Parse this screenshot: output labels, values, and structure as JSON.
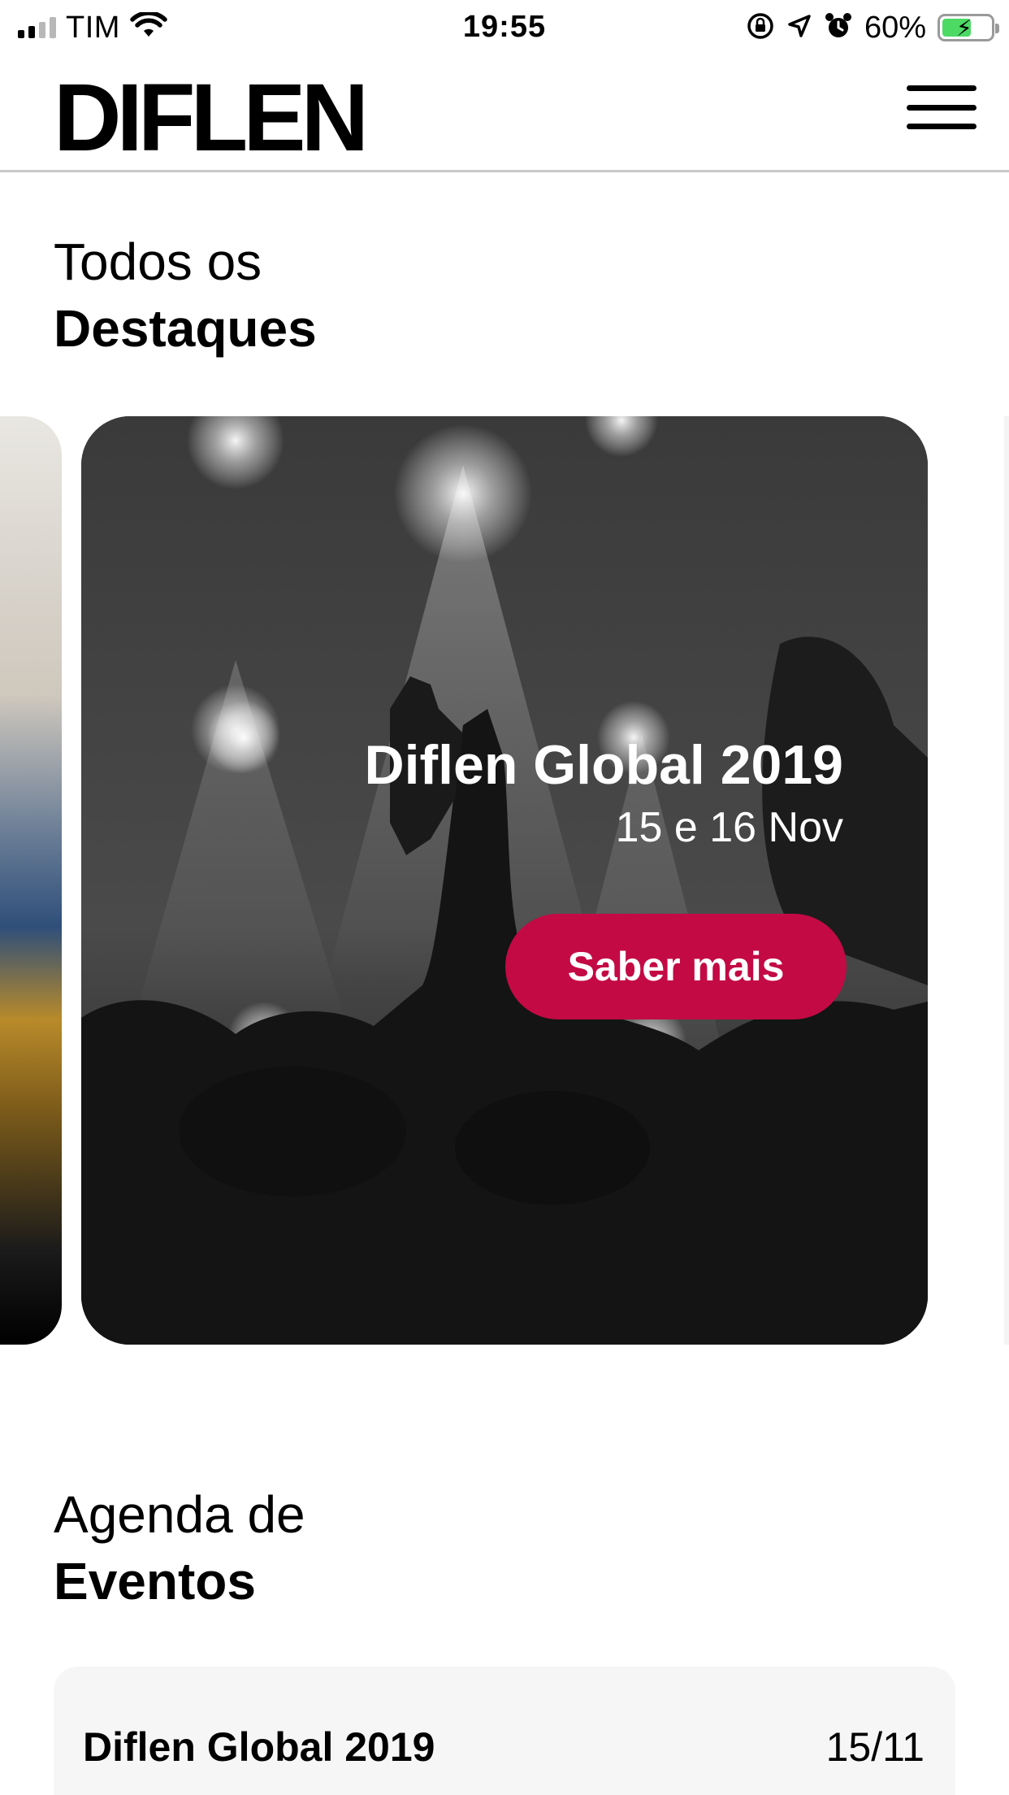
{
  "status_bar": {
    "carrier": "TIM",
    "time": "19:55",
    "battery_percent": "60%",
    "battery_level": 0.6,
    "icons": [
      "signal-icon",
      "wifi-icon",
      "orientation-lock-icon",
      "location-icon",
      "alarm-icon",
      "battery-charging-icon"
    ]
  },
  "header": {
    "logo": "DIFLEN",
    "menu_icon": "hamburger-menu-icon"
  },
  "highlights": {
    "title_light": "Todos os",
    "title_bold": "Destaques",
    "card": {
      "title": "Diflen Global 2019",
      "date": "15 e 16 Nov",
      "cta": "Saber mais",
      "cta_color": "#c30a45"
    }
  },
  "agenda": {
    "title_light": "Agenda de",
    "title_bold": "Eventos",
    "events": [
      {
        "name": "Diflen Global 2019",
        "date": "15/11"
      }
    ]
  }
}
